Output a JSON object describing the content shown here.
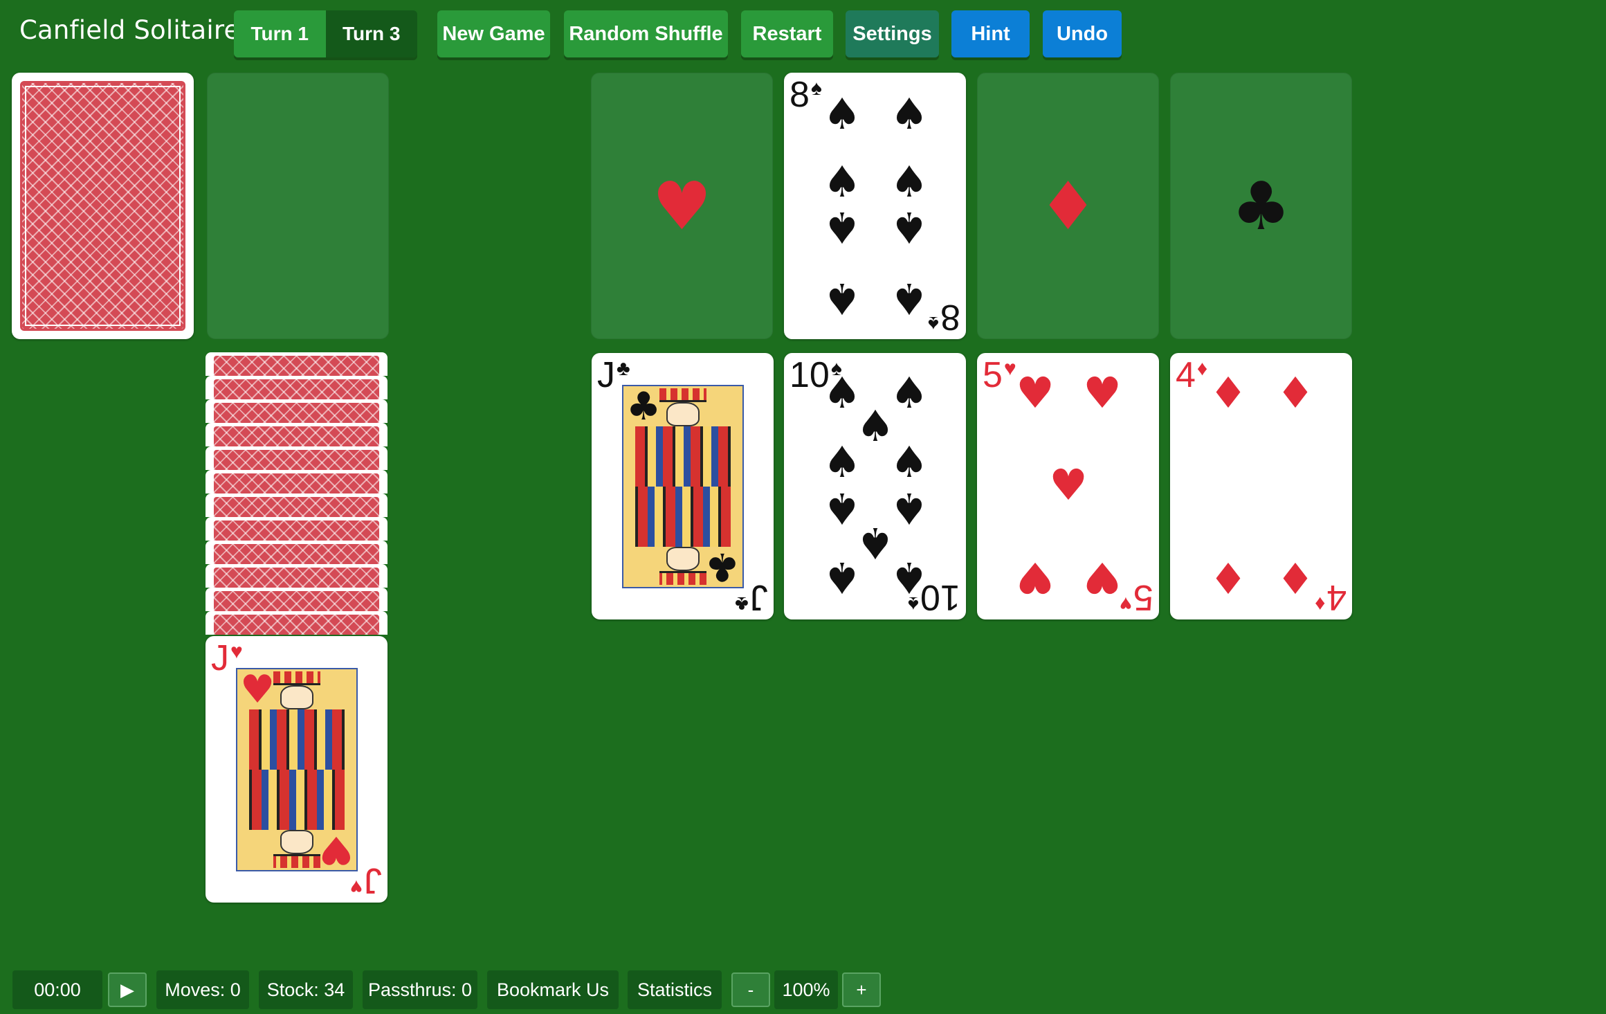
{
  "header": {
    "title": "Canfield Solitaire",
    "turn_options": [
      "Turn 1",
      "Turn 3"
    ],
    "active_turn": "Turn 1",
    "buttons": {
      "new_game": "New Game",
      "random_shuffle": "Random Shuffle",
      "restart": "Restart",
      "settings": "Settings",
      "hint": "Hint",
      "undo": "Undo"
    }
  },
  "colors": {
    "felt": "#1c6e1e",
    "slot": "#2f8038",
    "green_button": "#2a9a3a",
    "blue_button": "#0c7fd6",
    "card_red": "#e22b38",
    "card_black": "#111111",
    "card_back": "#d44a55"
  },
  "stock": {
    "state": "face-down"
  },
  "waste": {
    "state": "empty"
  },
  "foundations": [
    {
      "suit_symbol": "♥",
      "state": "empty",
      "icon": "heart-icon"
    },
    {
      "rank": "8",
      "suit_symbol": "♠",
      "state": "face-up"
    },
    {
      "suit_symbol": "♦",
      "state": "empty",
      "icon": "diamond-icon"
    },
    {
      "suit_symbol": "♣",
      "state": "empty",
      "icon": "club-icon"
    }
  ],
  "reserve": {
    "face_down_count": 12,
    "top_card": {
      "rank": "J",
      "suit_symbol": "♥"
    }
  },
  "tableau": [
    {
      "rank": "J",
      "suit_symbol": "♣"
    },
    {
      "rank": "10",
      "suit_symbol": "♠"
    },
    {
      "rank": "5",
      "suit_symbol": "♥"
    },
    {
      "rank": "4",
      "suit_symbol": "♦"
    }
  ],
  "footer": {
    "timer": "00:00",
    "play_symbol": "▶",
    "moves": "Moves: 0",
    "stock": "Stock: 34",
    "passthrus": "Passthrus: 0",
    "bookmark": "Bookmark Us",
    "statistics": "Statistics",
    "zoom_out": "-",
    "zoom": "100%",
    "zoom_in": "+"
  }
}
